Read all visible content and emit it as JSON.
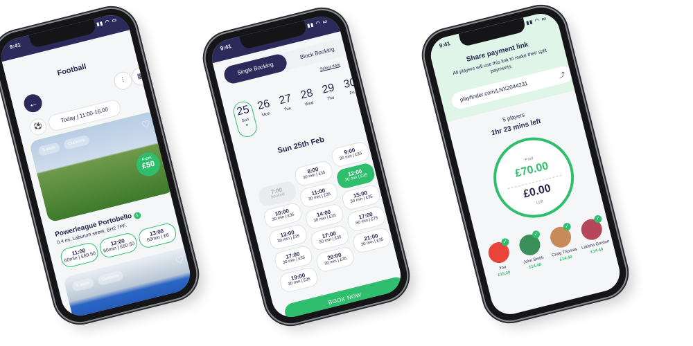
{
  "status": {
    "time": "9:41"
  },
  "phone1": {
    "title": "Football",
    "date_filter": {
      "day": "Today",
      "range": "11:00-16:00"
    },
    "venue1": {
      "tags": [
        "5 aside",
        "Outdoors"
      ],
      "price_label": "From",
      "price": "£50",
      "name": "Powerleague Portobello",
      "count_badge": "1",
      "address": "0.4 mi. Laburum street, EH2 7PF.",
      "slots": [
        {
          "time": "11:00",
          "detail": "60min | £69.50"
        },
        {
          "time": "12:00",
          "detail": "60min | £60.50"
        },
        {
          "time": "13:00",
          "detail": "60min | £6"
        }
      ]
    },
    "venue2": {
      "tags": [
        "5 aside",
        "Outdoors"
      ]
    }
  },
  "phone2": {
    "tabs": {
      "active": "Single Booking",
      "inactive": "Block Booking"
    },
    "select_date": "Select date",
    "days": [
      {
        "num": "25",
        "wd": "Sun"
      },
      {
        "num": "26",
        "wd": "Mon"
      },
      {
        "num": "27",
        "wd": "Tue"
      },
      {
        "num": "28",
        "wd": "Wed"
      },
      {
        "num": "29",
        "wd": "Thu"
      },
      {
        "num": "30",
        "wd": "Fri"
      }
    ],
    "date_heading": "Sun 25th Feb",
    "time_slots": [
      {
        "time": "9:00",
        "detail": "30 min | £35"
      },
      {
        "time": "8:00",
        "detail": "30 min | £35"
      },
      {
        "time": "12:00",
        "detail": "30 min | £35"
      },
      {
        "time": "7:00",
        "detail": "booked"
      },
      {
        "time": "11:00",
        "detail": "30 min | £35"
      },
      {
        "time": "15:00",
        "detail": "30 min | £35"
      },
      {
        "time": "10:00",
        "detail": "30 min | £35"
      },
      {
        "time": "14:00",
        "detail": "30 min | £35"
      },
      {
        "time": "17:00",
        "detail": "60 min | £75"
      },
      {
        "time": "13:00",
        "detail": "30 min | £35"
      },
      {
        "time": "17:00",
        "detail": "30 min | £35"
      },
      {
        "time": "21:00",
        "detail": "30 min | £35"
      },
      {
        "time": "17:00",
        "detail": "30 min | £35"
      },
      {
        "time": "20:00",
        "detail": "30 min | £35"
      },
      {
        "time": "19:00",
        "detail": "30 min | £35"
      }
    ],
    "book_button": "BOOK NOW"
  },
  "phone3": {
    "title": "Share payment link",
    "description": "All players will use this link to make their split payments.",
    "link": "playfinder.com/LNX2044231",
    "players_count": "5 players",
    "time_left": "1hr 23 mins left",
    "paid_label": "Paid",
    "paid_amount": "£70.00",
    "left_amount": "£0.00",
    "left_label": "Left",
    "players": [
      {
        "name": "You",
        "amount": "£15.20",
        "color": "#e8443a"
      },
      {
        "name": "John Smith",
        "amount": "£14.40",
        "color": "#3a8f5a"
      },
      {
        "name": "Craig Thomas",
        "amount": "£14.40",
        "color": "#c98a5a"
      },
      {
        "name": "Latisha Gordon",
        "amount": "£14.40",
        "color": "#b6475a"
      }
    ]
  },
  "colors": {
    "navy": "#2b2a5a",
    "green": "#2fbe6d"
  }
}
